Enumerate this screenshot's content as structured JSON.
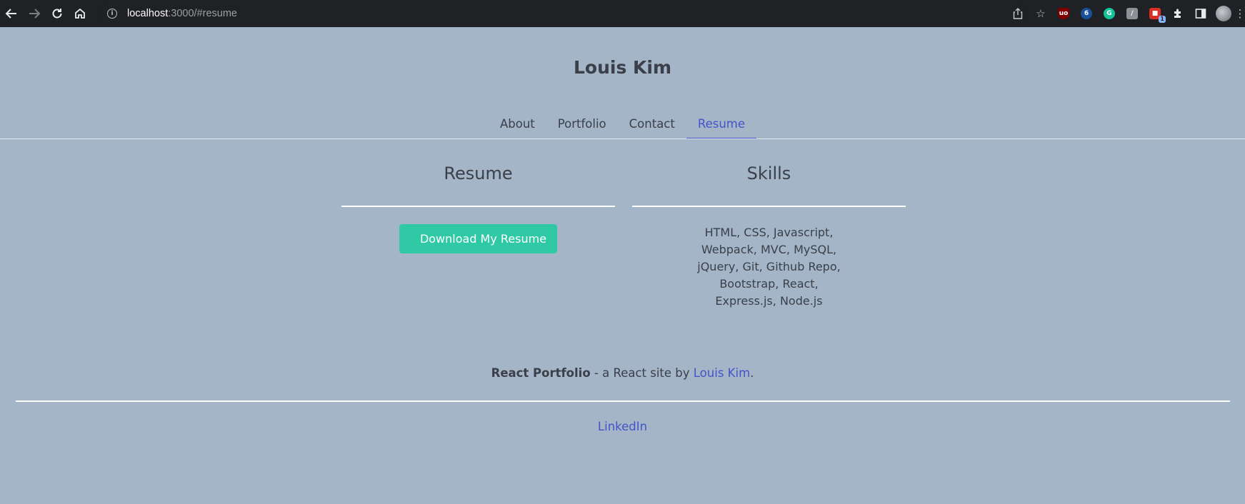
{
  "browser": {
    "url_host": "localhost",
    "url_path": ":3000/#resume",
    "back_icon": "arrow-left",
    "forward_icon": "arrow-right",
    "reload_icon": "reload",
    "home_icon": "home",
    "extension_badge": "1"
  },
  "site": {
    "title": "Louis Kim"
  },
  "nav": {
    "items": [
      {
        "label": "About"
      },
      {
        "label": "Portfolio"
      },
      {
        "label": "Contact"
      },
      {
        "label": "Resume",
        "active": true
      }
    ]
  },
  "resume": {
    "heading": "Resume",
    "button_label": "Download My Resume"
  },
  "skills": {
    "heading": "Skills",
    "text": "HTML, CSS, Javascript, Webpack, MVC, MySQL, jQuery, Git, Github Repo, Bootstrap, React, Express.js, Node.js"
  },
  "footer": {
    "project_name": "React Portfolio",
    "middle_text": " - a React site by ",
    "author_link": "Louis Kim",
    "end_text": ".",
    "linkedin": "LinkedIn"
  },
  "colors": {
    "page_background": "#a4b5c7",
    "accent": "#4454c8",
    "button": "#2fc9a6",
    "text": "#3a3f4a"
  }
}
